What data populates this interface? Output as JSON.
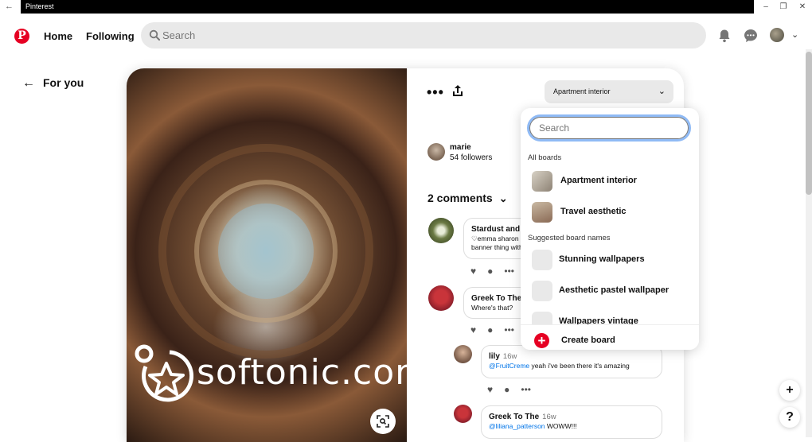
{
  "window": {
    "title": "Pinterest"
  },
  "header": {
    "logo": "P",
    "nav_home": "Home",
    "nav_following": "Following",
    "search_placeholder": "Search"
  },
  "page": {
    "back_title": "For you"
  },
  "pin": {
    "board_selector": "Apartment interior",
    "watermark": "softonic.com",
    "user": {
      "name": "marie",
      "followers": "54 followers"
    },
    "comments_title": "2 comments",
    "comments": [
      {
        "name": "Stardust and W",
        "line1": "♡emma sharon",
        "line2": "banner thing with"
      },
      {
        "name": "Greek To The",
        "line1": "Where's that?"
      },
      {
        "name": "lily",
        "time": "16w",
        "mention": "@FruitCreme",
        "text": " yeah i've been there it's amazing"
      },
      {
        "name": "Greek To The",
        "time": "16w",
        "mention": "@liliana_patterson",
        "text": " WOWW!!!"
      }
    ]
  },
  "dropdown": {
    "search_placeholder": "Search",
    "all_boards_label": "All boards",
    "boards": [
      {
        "name": "Apartment interior"
      },
      {
        "name": "Travel aesthetic"
      }
    ],
    "suggested_label": "Suggested board names",
    "suggested": [
      {
        "name": "Stunning wallpapers"
      },
      {
        "name": "Aesthetic pastel wallpaper"
      },
      {
        "name": "Wallpapers vintage"
      }
    ],
    "create_label": "Create board"
  },
  "fabs": {
    "add": "+",
    "help": "?"
  },
  "colors": {
    "brand": "#e60023",
    "mention": "#0074e8",
    "focus": "#8fbaf5"
  }
}
